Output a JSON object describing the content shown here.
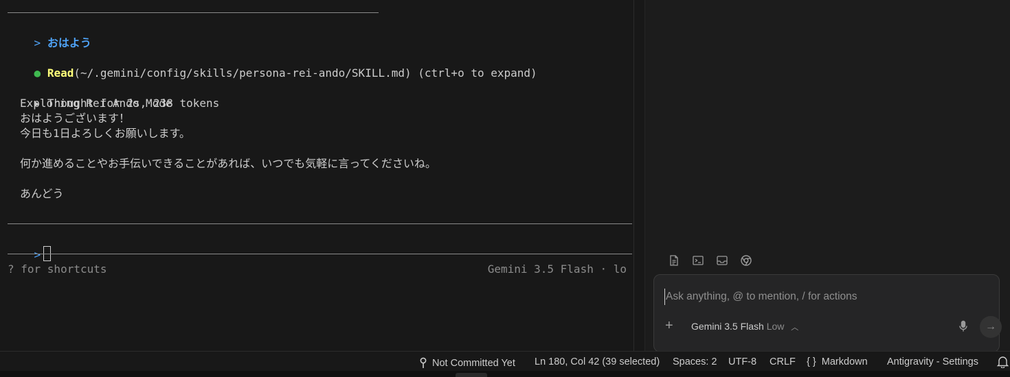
{
  "terminal": {
    "user_prompt_symbol": ">",
    "user_message": "おはよう",
    "read_dot": "●",
    "read_keyword": "Read",
    "read_path": "(~/.gemini/config/skills/persona-rei-ando/SKILL.md)",
    "read_hint": "(ctrl+o to expand)",
    "thought_marker": "▸",
    "thought_summary": "Thought for 2s, 238 tokens",
    "response_lines": [
      "Exploring Rei Ando Mode",
      "おはようございます！",
      "今日も1日よろしくお願いします。",
      "何か進めることやお手伝いできることがあれば、いつでも気軽に言ってくださいね。",
      "あんどう"
    ],
    "input_prompt_symbol": ">",
    "shortcuts_hint": "? for shortcuts",
    "model_status": "Gemini 3.5 Flash · lo"
  },
  "chat": {
    "context_icons": [
      "file-icon",
      "terminal-icon",
      "inbox-icon",
      "browser-icon"
    ],
    "input_placeholder": "Ask anything, @ to mention, / for actions",
    "add_symbol": "+",
    "model_name": "Gemini 3.5 Flash",
    "model_level": "Low",
    "send_symbol": "→"
  },
  "statusbar": {
    "git": "Not Committed Yet",
    "position": "Ln 180, Col 42 (39 selected)",
    "spaces": "Spaces: 2",
    "encoding": "UTF-8",
    "eol": "CRLF",
    "language_symbol": "{ }",
    "language": "Markdown",
    "settings": "Antigravity - Settings"
  },
  "colors": {
    "background": "#181818",
    "prompt_blue": "#4fa3f7",
    "read_yellow": "#ffff7a",
    "status_green": "#3fb950"
  }
}
